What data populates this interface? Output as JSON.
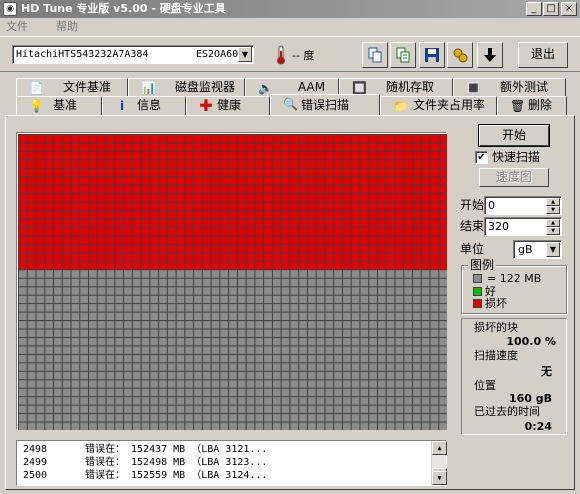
{
  "window": {
    "title": "HD Tune 专业版 v5.00 - 硬盘专业工具",
    "controls": {
      "minimize": "_",
      "maximize": "□",
      "close": "×"
    }
  },
  "menu": {
    "items": [
      "文件",
      "帮助"
    ]
  },
  "toolbar": {
    "drive_model": "HitachiHTS543232A7A384",
    "drive_firmware": "ES2OA60",
    "temperature": "-- 度",
    "exit_label": "退出",
    "buttons": [
      "copy-text-icon",
      "copy-info-icon",
      "save-icon",
      "options-icon",
      "download-icon"
    ]
  },
  "tabs": {
    "row1": [
      "文件基准",
      "磁盘监视器",
      "AAM",
      "随机存取",
      "额外测试"
    ],
    "row2": [
      "基准",
      "信息",
      "健康",
      "错误扫描",
      "文件夹占用率",
      "删除"
    ],
    "active": "错误扫描"
  },
  "scan": {
    "grid": {
      "cols": 49,
      "rows": 35,
      "damaged_rows": 16
    },
    "colors": {
      "damaged": "#e40000",
      "unscanned": "#8c8c8c",
      "ok": "#00c000",
      "grid_line": "#404040"
    }
  },
  "controls": {
    "start_label": "开始",
    "quick_scan_label": "快速扫描",
    "quick_scan_checked": true,
    "speed_map_label": "速度图",
    "start_field_label": "开始",
    "start_value": "0",
    "end_field_label": "结束",
    "end_value": "320",
    "unit_label": "单位",
    "unit_value": "gB"
  },
  "legend": {
    "title": "图例",
    "block_size": "= 122 MB",
    "ok_label": "好",
    "damaged_label": "损坏"
  },
  "stats": {
    "damaged_blocks_label": "损坏的块",
    "damaged_blocks_value": "100.0 %",
    "scan_speed_label": "扫描速度",
    "scan_speed_value": "无",
    "position_label": "位置",
    "position_value": "160 gB",
    "elapsed_label": "已过去的时间",
    "elapsed_value": "0:24"
  },
  "log": [
    {
      "num": "2498",
      "msg": "错误在： 152437 MB （LBA 3121..."
    },
    {
      "num": "2499",
      "msg": "错误在： 152498 MB （LBA 3123..."
    },
    {
      "num": "2500",
      "msg": "错误在： 152559 MB （LBA 3124..."
    }
  ]
}
